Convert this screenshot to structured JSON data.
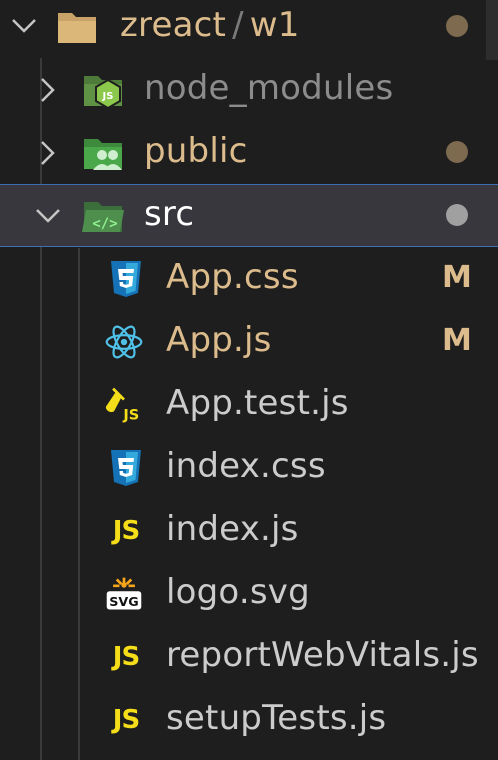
{
  "tree": {
    "root": {
      "name_part1": "zreact",
      "separator": "/",
      "name_part2": "w1",
      "expanded": true,
      "status_dot_color": "#7d6a4f"
    },
    "folders": [
      {
        "name": "node_modules",
        "color": "#8c8c8c",
        "icon": "nodejs-folder-icon",
        "expanded": false
      },
      {
        "name": "public",
        "color": "#dcbc8c",
        "icon": "people-folder-icon",
        "expanded": false,
        "status_dot_color": "#7d6a4f"
      },
      {
        "name": "src",
        "color": "#ffffff",
        "icon": "source-folder-icon",
        "expanded": true,
        "status_dot_color": "#a0a0a0"
      }
    ],
    "files": [
      {
        "name": "App.css",
        "icon": "css3-icon",
        "color": "#dcbc8c",
        "badge": "M"
      },
      {
        "name": "App.js",
        "icon": "react-icon",
        "color": "#dcbc8c",
        "badge": "M"
      },
      {
        "name": "App.test.js",
        "icon": "test-js-icon",
        "color": "#cccccc"
      },
      {
        "name": "index.css",
        "icon": "css3-icon",
        "color": "#cccccc"
      },
      {
        "name": "index.js",
        "icon": "js-icon",
        "color": "#cccccc",
        "icon_text": "JS"
      },
      {
        "name": "logo.svg",
        "icon": "svg-icon",
        "color": "#cccccc",
        "icon_text": "SVG"
      },
      {
        "name": "reportWebVitals.js",
        "icon": "js-icon",
        "color": "#cccccc",
        "icon_text": "JS"
      },
      {
        "name": "setupTests.js",
        "icon": "js-icon",
        "color": "#cccccc",
        "icon_text": "JS"
      }
    ],
    "colors": {
      "modified": "#dcbc8c",
      "selection_border": "#3f6fb3",
      "selection_bg": "#37373d"
    }
  }
}
